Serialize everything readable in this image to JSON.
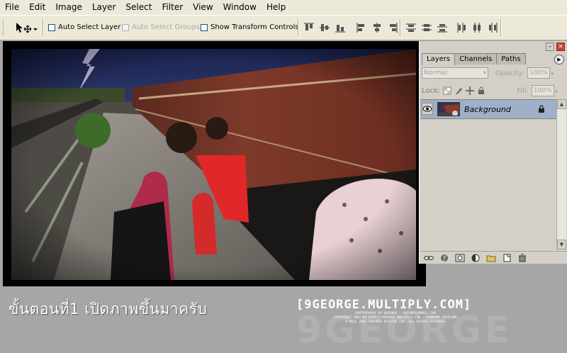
{
  "menu": [
    "File",
    "Edit",
    "Image",
    "Layer",
    "Select",
    "Filter",
    "View",
    "Window",
    "Help"
  ],
  "options": {
    "auto_select_layer": "Auto Select Layer",
    "auto_select_groups": "Auto Select Groups",
    "show_transform_controls": "Show Transform Controls"
  },
  "layers_panel": {
    "tabs": [
      "Layers",
      "Channels",
      "Paths"
    ],
    "blend_mode": "Normal",
    "opacity_label": "Opacity:",
    "opacity_value": "100%",
    "lock_label": "Lock:",
    "fill_label": "Fill:",
    "fill_value": "100%",
    "layer_name": "Background"
  },
  "caption": "ขั้นตอนที่1  เปิดภาพขึ้นมาครับ",
  "watermark": {
    "main": "[9GEORGE.MULTIPLY.COM]",
    "line1": "PHOTOGRAPHY BY 9GEORGE : 9GEORGE@GMAIL.COM",
    "line2": "COPYRIGHT 2007 BY HTTP://9GEORGE.MULTIPLY.COM , LAMPHUN THAILAND",
    "line3": "E-MAIL 2007 9GEORGE DIGITAL INC. ALL RIGHTS RESERVED",
    "ghost": "9GEORGE"
  }
}
